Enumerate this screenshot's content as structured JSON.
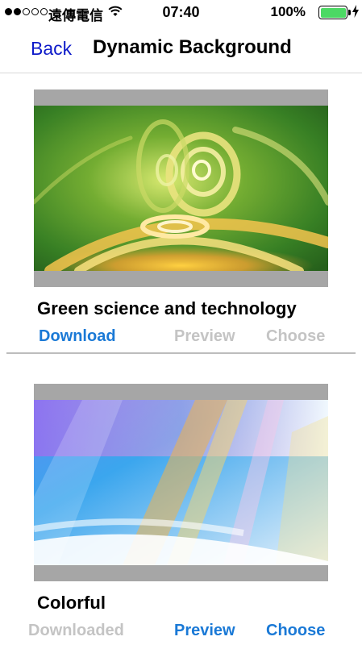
{
  "status_bar": {
    "carrier": "遠傳電信",
    "time": "07:40",
    "battery": "100%",
    "signal_icon": "signal-dots-icon",
    "wifi_icon": "wifi-icon",
    "battery_icon": "battery-icon",
    "charging_icon": "charging-bolt-icon",
    "battery_color": "#4cd964"
  },
  "nav": {
    "back_label": "Back",
    "title": "Dynamic Background",
    "back_color": "#0d1ac9"
  },
  "items": [
    {
      "title": "Green science and technology",
      "actions": [
        {
          "label": "Download",
          "state": "active"
        },
        {
          "label": "Preview",
          "state": "disabled"
        },
        {
          "label": "Choose",
          "state": "disabled"
        }
      ]
    },
    {
      "title": "Colorful",
      "actions": [
        {
          "label": "Downloaded",
          "state": "disabled"
        },
        {
          "label": "Preview",
          "state": "active"
        },
        {
          "label": "Choose",
          "state": "active"
        }
      ]
    }
  ],
  "colors": {
    "action_active": "#1a79d6",
    "action_disabled": "#c4c4c4",
    "thumb_frame": "#a6a6a6"
  }
}
